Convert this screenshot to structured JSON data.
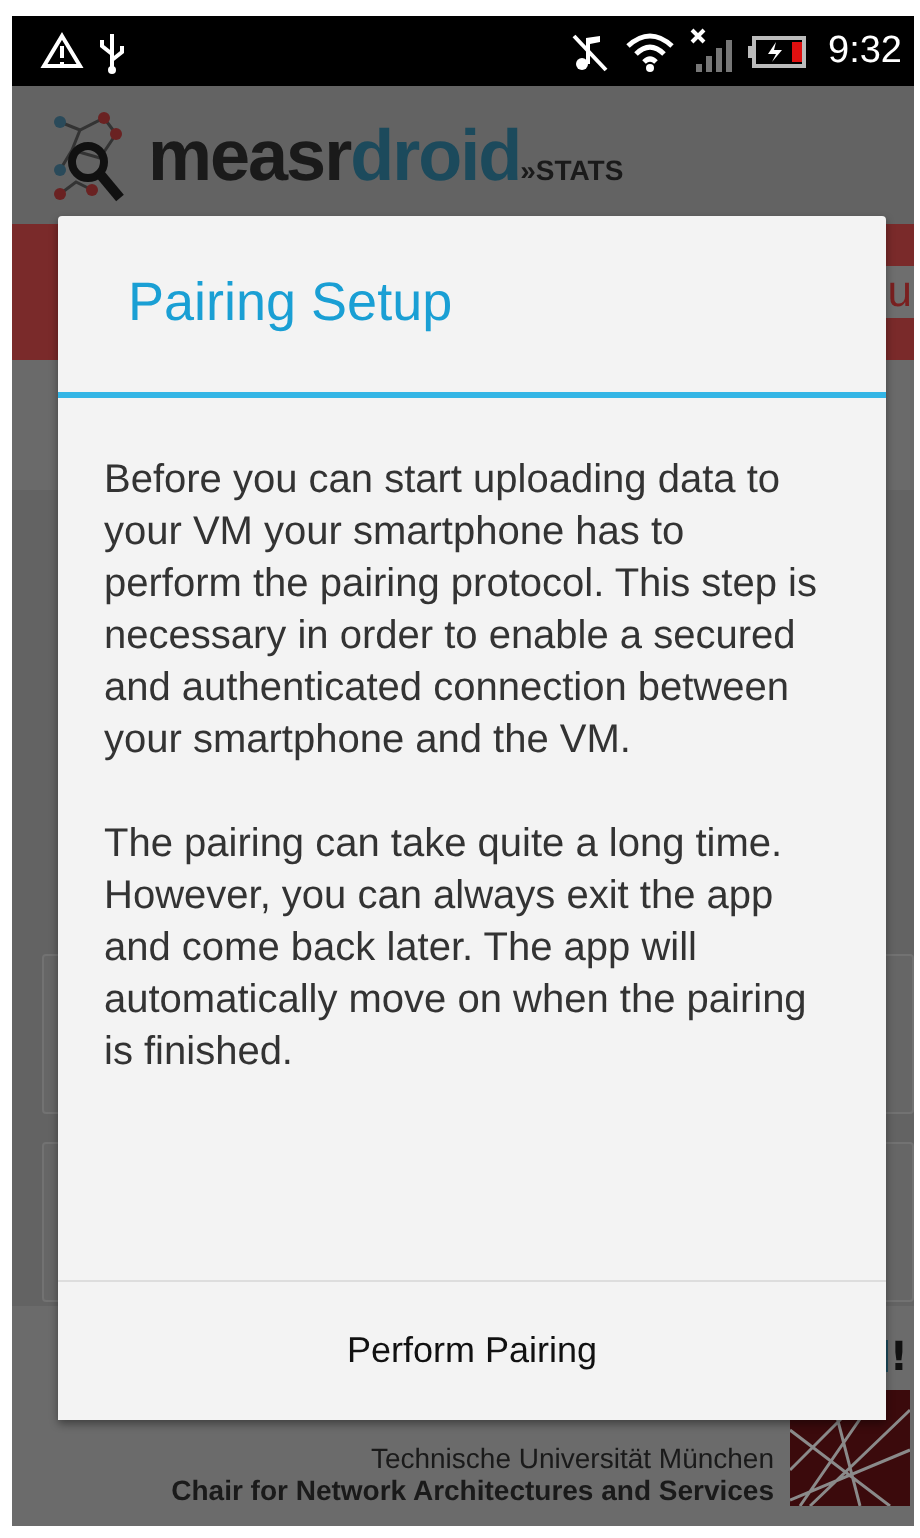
{
  "status_bar": {
    "time": "9:32"
  },
  "app": {
    "logo": {
      "part_1": "measr",
      "part_2": "droid",
      "part_3": "»STATS"
    },
    "banner_fragment": "u",
    "notice_fragment": "!",
    "footer": {
      "university": "Technische Universität München",
      "chair": "Chair for Network Architectures and Services"
    }
  },
  "dialog": {
    "title": "Pairing Setup",
    "paragraphs": [
      "Before you can start uploading data to your VM your smartphone has to perform the pairing protocol. This step is necessary in order to enable a secured and authenticated connection between your smartphone and the VM.",
      "The pairing can take quite a long time. However, you can always exit the app and come back later. The app will automatically move on when the pairing is finished."
    ],
    "buttons": [
      {
        "label": "Perform Pairing"
      }
    ]
  }
}
